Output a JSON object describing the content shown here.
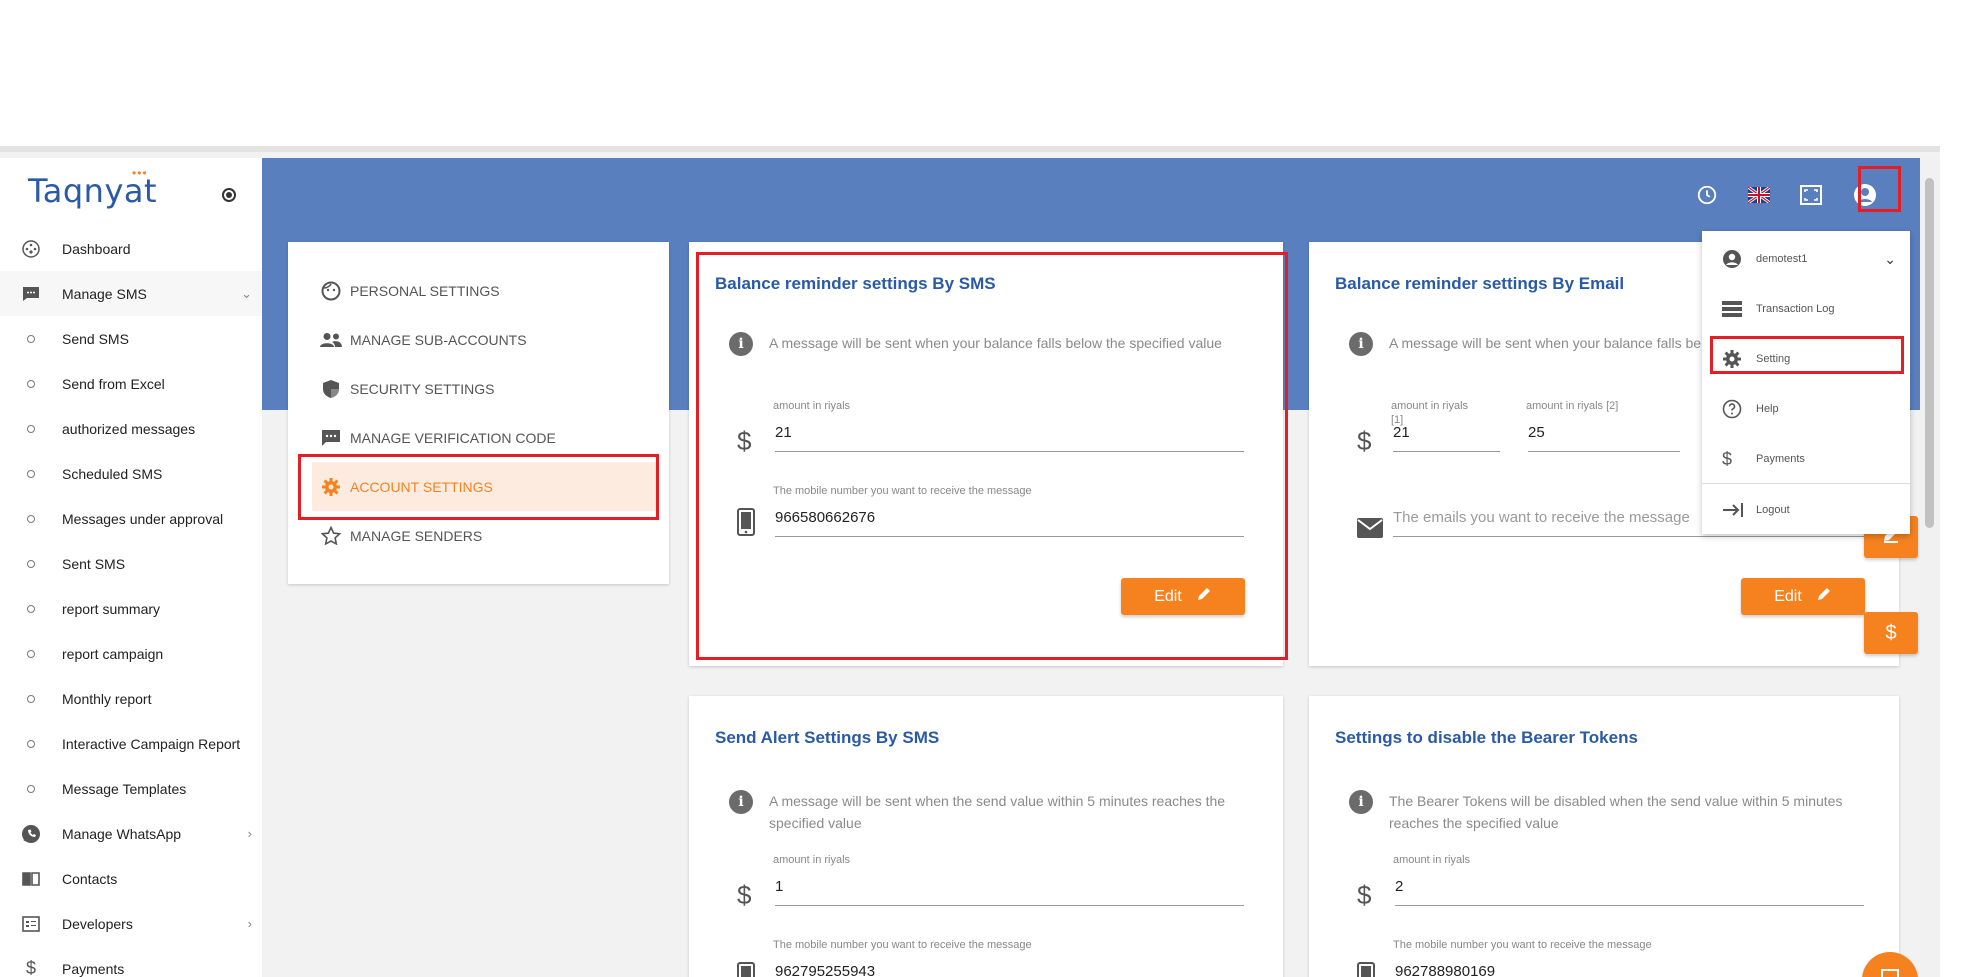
{
  "brand": {
    "name": "Taqnyat",
    "dots": "•••"
  },
  "sidebar": {
    "items": [
      {
        "label": "Dashboard",
        "icon": "dashboard-icon",
        "type": "main"
      },
      {
        "label": "Manage SMS",
        "icon": "sms-icon",
        "type": "main",
        "expanded": true
      },
      {
        "label": "Send SMS",
        "type": "sub"
      },
      {
        "label": "Send from Excel",
        "type": "sub"
      },
      {
        "label": "authorized messages",
        "type": "sub"
      },
      {
        "label": "Scheduled SMS",
        "type": "sub"
      },
      {
        "label": "Messages under approval",
        "type": "sub"
      },
      {
        "label": "Sent SMS",
        "type": "sub"
      },
      {
        "label": "report summary",
        "type": "sub"
      },
      {
        "label": "report campaign",
        "type": "sub"
      },
      {
        "label": "Monthly report",
        "type": "sub"
      },
      {
        "label": "Interactive Campaign Report",
        "type": "sub"
      },
      {
        "label": "Message Templates",
        "type": "sub"
      },
      {
        "label": "Manage WhatsApp",
        "icon": "whatsapp-icon",
        "type": "main"
      },
      {
        "label": "Contacts",
        "icon": "contacts-icon",
        "type": "main"
      },
      {
        "label": "Developers",
        "icon": "developers-icon",
        "type": "main"
      },
      {
        "label": "Payments",
        "icon": "dollar-icon",
        "type": "main"
      }
    ]
  },
  "settings_menu": {
    "items": [
      {
        "label": "PERSONAL SETTINGS",
        "icon": "face-icon"
      },
      {
        "label": "MANAGE SUB-ACCOUNTS",
        "icon": "group-icon"
      },
      {
        "label": "SECURITY SETTINGS",
        "icon": "shield-icon"
      },
      {
        "label": "MANAGE VERIFICATION CODE",
        "icon": "chat-icon"
      },
      {
        "label": "ACCOUNT SETTINGS",
        "icon": "gear-icon",
        "active": true
      },
      {
        "label": "MANAGE SENDERS",
        "icon": "star-icon"
      }
    ]
  },
  "cards": {
    "sms_balance": {
      "title": "Balance reminder settings By SMS",
      "info": "A message will be sent when your balance falls below the specified value",
      "amount_label": "amount in riyals",
      "amount_value": "21",
      "mobile_label": "The mobile number you want to receive the message",
      "mobile_value": "966580662676",
      "edit_label": "Edit"
    },
    "email_balance": {
      "title": "Balance reminder settings By Email",
      "info": "A message will be sent when your balance falls be",
      "amount1_label": "amount in riyals",
      "amount1_suffix": "[1]",
      "amount1_value": "21",
      "amount2_label": "amount in riyals [2]",
      "amount2_value": "25",
      "emails_placeholder": "The emails you want to receive the message",
      "edit_label": "Edit"
    },
    "sms_alert": {
      "title": "Send Alert Settings By SMS",
      "info": "A message will be sent when the send value within 5 minutes reaches the specified value",
      "amount_label": "amount in riyals",
      "amount_value": "1",
      "mobile_label": "The mobile number you want to receive the message",
      "mobile_value": "962795255943"
    },
    "bearer": {
      "title": "Settings to disable the Bearer Tokens",
      "info": "The Bearer Tokens will be disabled when the send value within 5 minutes reaches the specified value",
      "amount_label": "amount in riyals",
      "amount_value": "2",
      "mobile_label": "The mobile number you want to receive the message",
      "mobile_value": "962788980169"
    }
  },
  "user_menu": {
    "username": "demotest1",
    "items": [
      {
        "label": "Transaction Log",
        "icon": "list-icon"
      },
      {
        "label": "Setting",
        "icon": "gear-icon"
      },
      {
        "label": "Help",
        "icon": "help-icon"
      },
      {
        "label": "Payments",
        "icon": "dollar-icon"
      },
      {
        "label": "Logout",
        "icon": "logout-icon"
      }
    ]
  },
  "colors": {
    "accent": "#f5821f",
    "header": "#5a7fbf",
    "title": "#2a5aa5",
    "highlight": "#e31e24"
  }
}
